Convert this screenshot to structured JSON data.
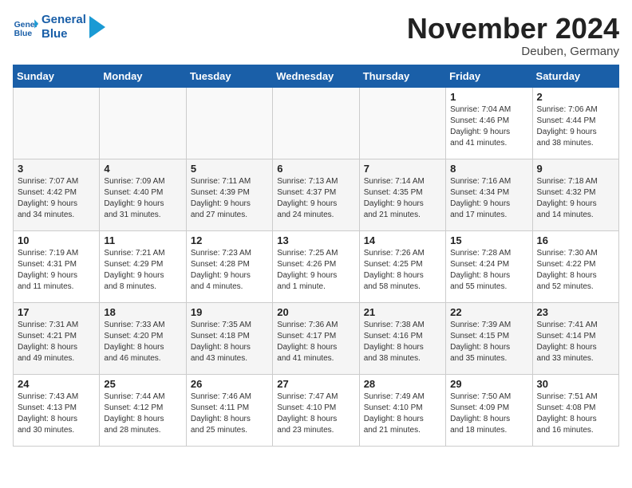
{
  "header": {
    "logo_line1": "General",
    "logo_line2": "Blue",
    "month": "November 2024",
    "location": "Deuben, Germany"
  },
  "weekdays": [
    "Sunday",
    "Monday",
    "Tuesday",
    "Wednesday",
    "Thursday",
    "Friday",
    "Saturday"
  ],
  "weeks": [
    [
      {
        "day": "",
        "info": ""
      },
      {
        "day": "",
        "info": ""
      },
      {
        "day": "",
        "info": ""
      },
      {
        "day": "",
        "info": ""
      },
      {
        "day": "",
        "info": ""
      },
      {
        "day": "1",
        "info": "Sunrise: 7:04 AM\nSunset: 4:46 PM\nDaylight: 9 hours\nand 41 minutes."
      },
      {
        "day": "2",
        "info": "Sunrise: 7:06 AM\nSunset: 4:44 PM\nDaylight: 9 hours\nand 38 minutes."
      }
    ],
    [
      {
        "day": "3",
        "info": "Sunrise: 7:07 AM\nSunset: 4:42 PM\nDaylight: 9 hours\nand 34 minutes."
      },
      {
        "day": "4",
        "info": "Sunrise: 7:09 AM\nSunset: 4:40 PM\nDaylight: 9 hours\nand 31 minutes."
      },
      {
        "day": "5",
        "info": "Sunrise: 7:11 AM\nSunset: 4:39 PM\nDaylight: 9 hours\nand 27 minutes."
      },
      {
        "day": "6",
        "info": "Sunrise: 7:13 AM\nSunset: 4:37 PM\nDaylight: 9 hours\nand 24 minutes."
      },
      {
        "day": "7",
        "info": "Sunrise: 7:14 AM\nSunset: 4:35 PM\nDaylight: 9 hours\nand 21 minutes."
      },
      {
        "day": "8",
        "info": "Sunrise: 7:16 AM\nSunset: 4:34 PM\nDaylight: 9 hours\nand 17 minutes."
      },
      {
        "day": "9",
        "info": "Sunrise: 7:18 AM\nSunset: 4:32 PM\nDaylight: 9 hours\nand 14 minutes."
      }
    ],
    [
      {
        "day": "10",
        "info": "Sunrise: 7:19 AM\nSunset: 4:31 PM\nDaylight: 9 hours\nand 11 minutes."
      },
      {
        "day": "11",
        "info": "Sunrise: 7:21 AM\nSunset: 4:29 PM\nDaylight: 9 hours\nand 8 minutes."
      },
      {
        "day": "12",
        "info": "Sunrise: 7:23 AM\nSunset: 4:28 PM\nDaylight: 9 hours\nand 4 minutes."
      },
      {
        "day": "13",
        "info": "Sunrise: 7:25 AM\nSunset: 4:26 PM\nDaylight: 9 hours\nand 1 minute."
      },
      {
        "day": "14",
        "info": "Sunrise: 7:26 AM\nSunset: 4:25 PM\nDaylight: 8 hours\nand 58 minutes."
      },
      {
        "day": "15",
        "info": "Sunrise: 7:28 AM\nSunset: 4:24 PM\nDaylight: 8 hours\nand 55 minutes."
      },
      {
        "day": "16",
        "info": "Sunrise: 7:30 AM\nSunset: 4:22 PM\nDaylight: 8 hours\nand 52 minutes."
      }
    ],
    [
      {
        "day": "17",
        "info": "Sunrise: 7:31 AM\nSunset: 4:21 PM\nDaylight: 8 hours\nand 49 minutes."
      },
      {
        "day": "18",
        "info": "Sunrise: 7:33 AM\nSunset: 4:20 PM\nDaylight: 8 hours\nand 46 minutes."
      },
      {
        "day": "19",
        "info": "Sunrise: 7:35 AM\nSunset: 4:18 PM\nDaylight: 8 hours\nand 43 minutes."
      },
      {
        "day": "20",
        "info": "Sunrise: 7:36 AM\nSunset: 4:17 PM\nDaylight: 8 hours\nand 41 minutes."
      },
      {
        "day": "21",
        "info": "Sunrise: 7:38 AM\nSunset: 4:16 PM\nDaylight: 8 hours\nand 38 minutes."
      },
      {
        "day": "22",
        "info": "Sunrise: 7:39 AM\nSunset: 4:15 PM\nDaylight: 8 hours\nand 35 minutes."
      },
      {
        "day": "23",
        "info": "Sunrise: 7:41 AM\nSunset: 4:14 PM\nDaylight: 8 hours\nand 33 minutes."
      }
    ],
    [
      {
        "day": "24",
        "info": "Sunrise: 7:43 AM\nSunset: 4:13 PM\nDaylight: 8 hours\nand 30 minutes."
      },
      {
        "day": "25",
        "info": "Sunrise: 7:44 AM\nSunset: 4:12 PM\nDaylight: 8 hours\nand 28 minutes."
      },
      {
        "day": "26",
        "info": "Sunrise: 7:46 AM\nSunset: 4:11 PM\nDaylight: 8 hours\nand 25 minutes."
      },
      {
        "day": "27",
        "info": "Sunrise: 7:47 AM\nSunset: 4:10 PM\nDaylight: 8 hours\nand 23 minutes."
      },
      {
        "day": "28",
        "info": "Sunrise: 7:49 AM\nSunset: 4:10 PM\nDaylight: 8 hours\nand 21 minutes."
      },
      {
        "day": "29",
        "info": "Sunrise: 7:50 AM\nSunset: 4:09 PM\nDaylight: 8 hours\nand 18 minutes."
      },
      {
        "day": "30",
        "info": "Sunrise: 7:51 AM\nSunset: 4:08 PM\nDaylight: 8 hours\nand 16 minutes."
      }
    ]
  ]
}
